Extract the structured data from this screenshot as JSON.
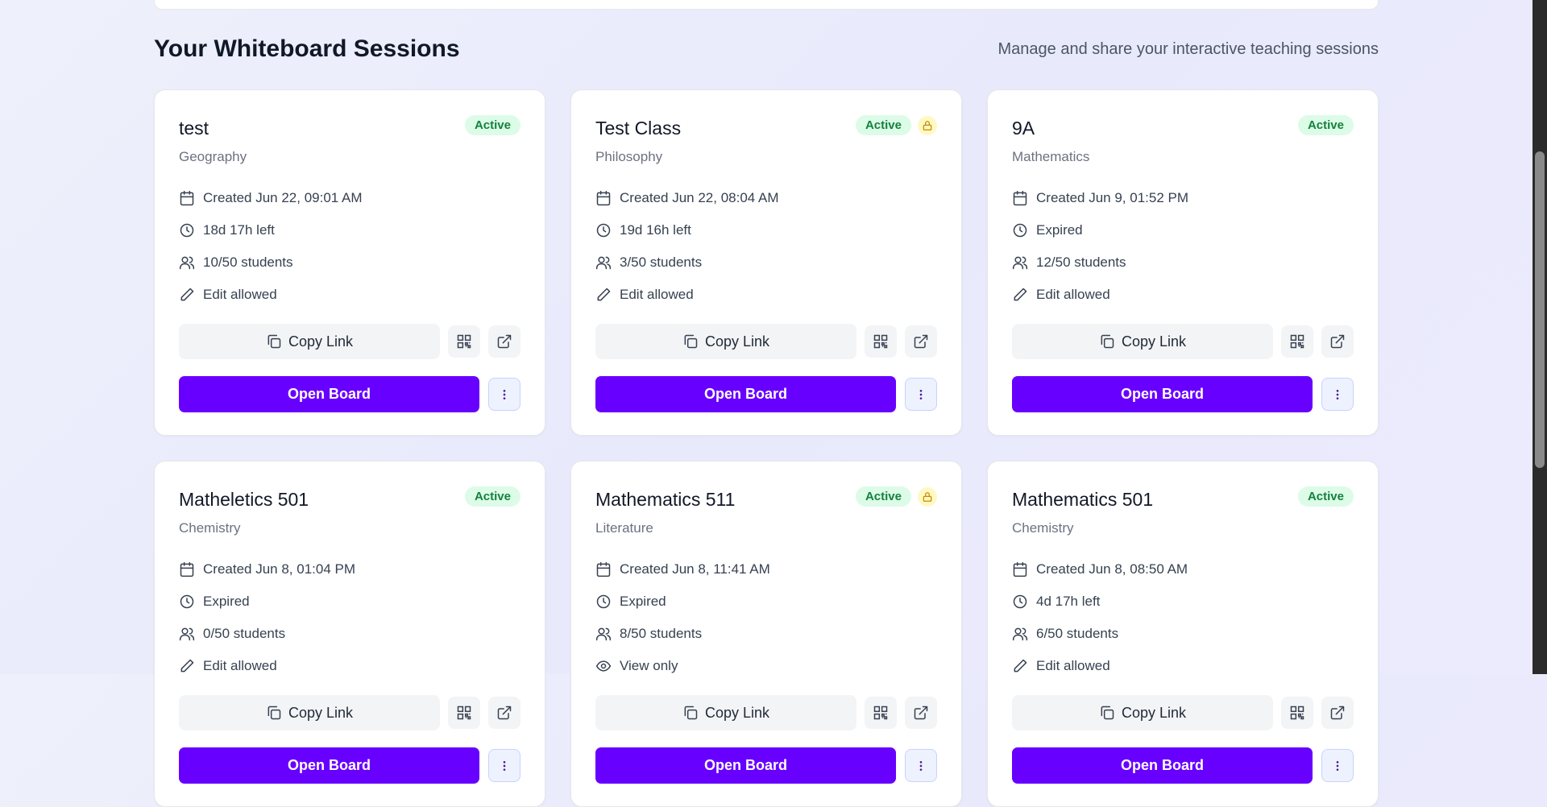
{
  "section": {
    "title": "Your Whiteboard Sessions",
    "subtitle": "Manage and share your interactive teaching sessions"
  },
  "labels": {
    "copy_link": "Copy Link",
    "open_board": "Open Board"
  },
  "colors": {
    "primary": "#6800ff",
    "active_badge_bg": "#dcfce7",
    "active_badge_text": "#15803d",
    "lock_bg": "#fef9c3",
    "lock_icon": "#ca8a04"
  },
  "sessions": [
    {
      "name": "test",
      "status": "Active",
      "locked": false,
      "subject": "Geography",
      "created": "Created Jun 22, 09:01 AM",
      "time_left": "18d 17h left",
      "students": "10/50 students",
      "permission": "Edit allowed",
      "permission_icon": "pencil-icon"
    },
    {
      "name": "Test Class",
      "status": "Active",
      "locked": true,
      "subject": "Philosophy",
      "created": "Created Jun 22, 08:04 AM",
      "time_left": "19d 16h left",
      "students": "3/50 students",
      "permission": "Edit allowed",
      "permission_icon": "pencil-icon"
    },
    {
      "name": "9A",
      "status": "Active",
      "locked": false,
      "subject": "Mathematics",
      "created": "Created Jun 9, 01:52 PM",
      "time_left": "Expired",
      "students": "12/50 students",
      "permission": "Edit allowed",
      "permission_icon": "pencil-icon"
    },
    {
      "name": "Matheletics 501",
      "status": "Active",
      "locked": false,
      "subject": "Chemistry",
      "created": "Created Jun 8, 01:04 PM",
      "time_left": "Expired",
      "students": "0/50 students",
      "permission": "Edit allowed",
      "permission_icon": "pencil-icon"
    },
    {
      "name": "Mathematics 511",
      "status": "Active",
      "locked": true,
      "subject": "Literature",
      "created": "Created Jun 8, 11:41 AM",
      "time_left": "Expired",
      "students": "8/50 students",
      "permission": "View only",
      "permission_icon": "eye-icon"
    },
    {
      "name": "Mathematics 501",
      "status": "Active",
      "locked": false,
      "subject": "Chemistry",
      "created": "Created Jun 8, 08:50 AM",
      "time_left": "4d 17h left",
      "students": "6/50 students",
      "permission": "Edit allowed",
      "permission_icon": "pencil-icon"
    }
  ]
}
